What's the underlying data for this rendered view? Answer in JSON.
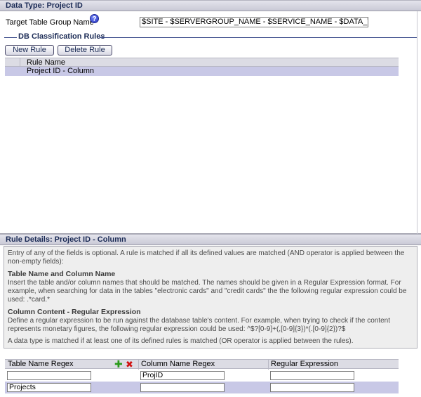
{
  "top_panel": {
    "title": "Data Type: Project ID",
    "target_label": "Target Table Group Name",
    "help_glyph": "?",
    "target_value": "$SITE - $SERVERGROUP_NAME - $SERVICE_NAME - $DATA_TYPE",
    "section_legend": "DB Classification Rules",
    "buttons": {
      "new_rule": "New Rule",
      "delete_rule": "Delete Rule"
    },
    "rules_table": {
      "column_header": "Rule Name",
      "rows": [
        "Project ID - Column"
      ]
    }
  },
  "bottom_panel": {
    "title": "Rule Details: Project ID - Column",
    "help": {
      "intro": "Entry of any of the fields is optional. A rule is matched if all its defined values are matched (AND operator is applied between the non-empty fields):",
      "section1_title": "Table Name and Column Name",
      "section1_text": "Insert the table and/or column names that should be matched. The names should be given in a Regular Expression format. For example, when searching for data in the tables \"electronic cards\" and \"credit cards\" the the following regular expression could be used: .*card.*",
      "section2_title": "Column Content - Regular Expression",
      "section2_text": "Define a regular expression to be run against the database table's content. For example, when trying to check if the content represents monetary figures, the following regular expression could be used: ^$?[0-9]+(,[0-9]{3})*(.[0-9]{2})?$",
      "footer": "A data type is matched if at least one of its defined rules is matched (OR operator is applied between the rules)."
    },
    "details_table": {
      "headers": {
        "table_name": "Table Name Regex",
        "column_name": "Column Name Regex",
        "regex": "Regular Expression"
      },
      "rows": [
        {
          "table_name": "",
          "column_name": "ProjID",
          "regex": ""
        },
        {
          "table_name": "Projects",
          "column_name": "",
          "regex": ""
        }
      ]
    }
  },
  "icons": {
    "add": "plus-icon",
    "remove": "x-icon",
    "help": "question-circle-icon"
  },
  "colors": {
    "header_text": "#1a2a55",
    "selected_row": "#c8c8e6",
    "add_icon": "#2a9a1a",
    "remove_icon": "#d01010"
  }
}
